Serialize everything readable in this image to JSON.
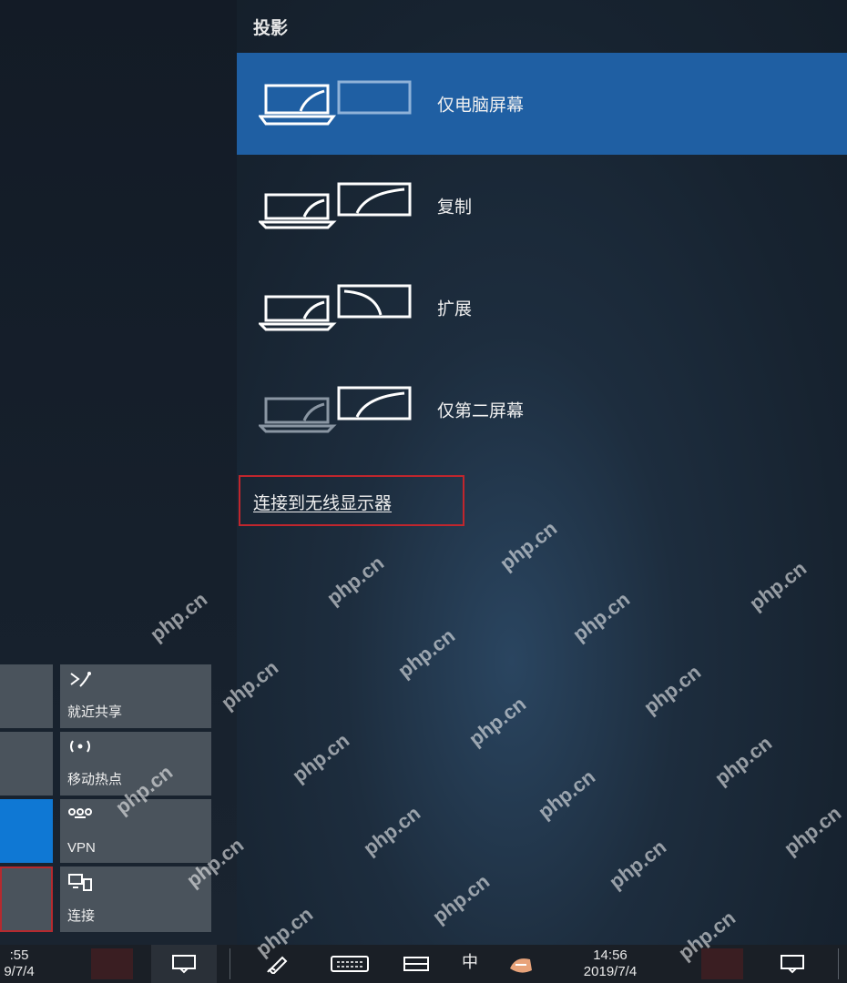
{
  "panel": {
    "title": "投影",
    "options": [
      {
        "label": "仅电脑屏幕",
        "selected": true
      },
      {
        "label": "复制",
        "selected": false
      },
      {
        "label": "扩展",
        "selected": false
      },
      {
        "label": "仅第二屏幕",
        "selected": false
      }
    ],
    "wireless_link": "连接到无线显示器"
  },
  "quick_actions": {
    "nearby_sharing": "就近共享",
    "mobile_hotspot": "移动热点",
    "vpn": "VPN",
    "connect": "连接"
  },
  "taskbar": {
    "left_time": ":55",
    "left_date": "9/7/4",
    "ime": "中",
    "time": "14:56",
    "date": "2019/7/4"
  },
  "watermark": "php.cn",
  "colors": {
    "accent": "#1f5fa3",
    "tile_blue": "#0f78d4",
    "highlight_red": "#c0262d"
  }
}
